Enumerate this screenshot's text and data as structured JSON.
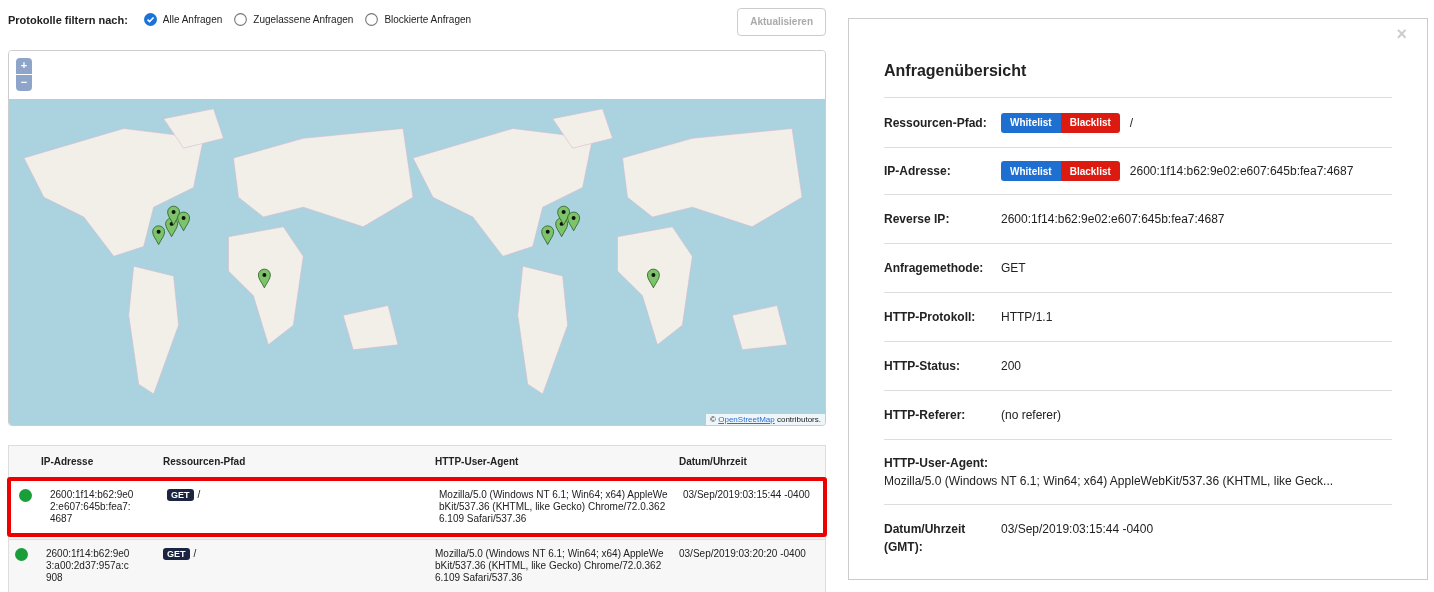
{
  "filter": {
    "label": "Protokolle filtern nach:",
    "options": [
      {
        "label": "Alle Anfragen",
        "selected": true
      },
      {
        "label": "Zugelassene Anfragen",
        "selected": false
      },
      {
        "label": "Blockierte Anfragen",
        "selected": false
      }
    ],
    "refresh_button": {
      "label": "Aktualisieren",
      "disabled": true
    }
  },
  "map": {
    "zoom_in": "+",
    "zoom_out": "−",
    "attribution_prefix": "©",
    "attribution_link": "OpenStreetMap",
    "attribution_suffix": "contributors."
  },
  "table": {
    "columns": [
      "IP-Adresse",
      "Ressourcen-Pfad",
      "HTTP-User-Agent",
      "Datum/Uhrzeit"
    ],
    "rows": [
      {
        "selected": true,
        "color": "#1a9e3a",
        "ip": "2600:1f14:b62:9e02:e607:645b:fea7:4687",
        "method": "GET",
        "path": "/",
        "user_agent": "Mozilla/5.0 (Windows NT 6.1; Win64; x64) AppleWebKit/537.36 (KHTML, like Gecko) Chrome/72.0.3626.109 Safari/537.36",
        "date": "03/Sep/2019:03:15:44 -0400"
      },
      {
        "selected": false,
        "color": "#1a9e3a",
        "ip": "2600:1f14:b62:9e03:a00:2d37:957a:c908",
        "method": "GET",
        "path": "/",
        "user_agent": "Mozilla/5.0 (Windows NT 6.1; Win64; x64) AppleWebKit/537.36 (KHTML, like Gecko) Chrome/72.0.3626.109 Safari/537.36",
        "date": "03/Sep/2019:03:20:20 -0400"
      }
    ]
  },
  "details": {
    "close": "×",
    "title": "Anfragenübersicht",
    "fields": [
      {
        "kind": "actions",
        "label": "Ressourcen-Pfad:",
        "whitelist": "Whitelist",
        "blacklist": "Blacklist",
        "value": "/"
      },
      {
        "kind": "actions",
        "label": "IP-Adresse:",
        "whitelist": "Whitelist",
        "blacklist": "Blacklist",
        "value": "2600:1f14:b62:9e02:e607:645b:fea7:4687"
      },
      {
        "kind": "plain",
        "label": "Reverse IP:",
        "value": "2600:1f14:b62:9e02:e607:645b:fea7:4687"
      },
      {
        "kind": "plain",
        "label": "Anfragemethode:",
        "value": "GET"
      },
      {
        "kind": "plain",
        "label": "HTTP-Protokoll:",
        "value": "HTTP/1.1"
      },
      {
        "kind": "plain",
        "label": "HTTP-Status:",
        "value": "200"
      },
      {
        "kind": "plain",
        "label": "HTTP-Referer:",
        "value": "(no referer)"
      },
      {
        "kind": "stacked",
        "label": "HTTP-User-Agent:",
        "value": "Mozilla/5.0 (Windows NT 6.1; Win64; x64) AppleWebKit/537.36 (KHTML, like Geck..."
      },
      {
        "kind": "plain",
        "label": "Datum/Uhrzeit (GMT):",
        "value": "03/Sep/2019:03:15:44 -0400"
      }
    ]
  }
}
